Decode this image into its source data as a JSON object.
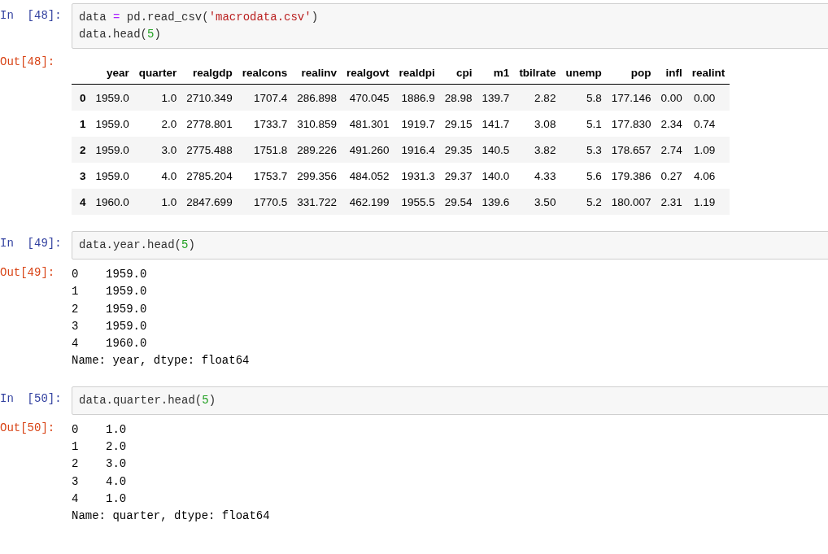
{
  "cells": [
    {
      "in_prompt": "In  [48]:",
      "code": [
        [
          {
            "kind": "name",
            "text": "data "
          },
          {
            "kind": "operator",
            "text": "="
          },
          {
            "kind": "name",
            "text": " pd.read_csv("
          },
          {
            "kind": "string",
            "text": "'macrodata.csv'"
          },
          {
            "kind": "name",
            "text": ")"
          }
        ],
        [
          {
            "kind": "name",
            "text": "data.head("
          },
          {
            "kind": "number",
            "text": "5"
          },
          {
            "kind": "name",
            "text": ")"
          }
        ]
      ],
      "out_prompt": "Out[48]:",
      "output": {
        "kind": "table",
        "columns": [
          "year",
          "quarter",
          "realgdp",
          "realcons",
          "realinv",
          "realgovt",
          "realdpi",
          "cpi",
          "m1",
          "tbilrate",
          "unemp",
          "pop",
          "infl",
          "realint"
        ],
        "rows": [
          {
            "index": "0",
            "cells": [
              "1959.0",
              "1.0",
              "2710.349",
              "1707.4",
              "286.898",
              "470.045",
              "1886.9",
              "28.98",
              "139.7",
              "2.82",
              "5.8",
              "177.146",
              "0.00",
              "0.00"
            ]
          },
          {
            "index": "1",
            "cells": [
              "1959.0",
              "2.0",
              "2778.801",
              "1733.7",
              "310.859",
              "481.301",
              "1919.7",
              "29.15",
              "141.7",
              "3.08",
              "5.1",
              "177.830",
              "2.34",
              "0.74"
            ]
          },
          {
            "index": "2",
            "cells": [
              "1959.0",
              "3.0",
              "2775.488",
              "1751.8",
              "289.226",
              "491.260",
              "1916.4",
              "29.35",
              "140.5",
              "3.82",
              "5.3",
              "178.657",
              "2.74",
              "1.09"
            ]
          },
          {
            "index": "3",
            "cells": [
              "1959.0",
              "4.0",
              "2785.204",
              "1753.7",
              "299.356",
              "484.052",
              "1931.3",
              "29.37",
              "140.0",
              "4.33",
              "5.6",
              "179.386",
              "0.27",
              "4.06"
            ]
          },
          {
            "index": "4",
            "cells": [
              "1960.0",
              "1.0",
              "2847.699",
              "1770.5",
              "331.722",
              "462.199",
              "1955.5",
              "29.54",
              "139.6",
              "3.50",
              "5.2",
              "180.007",
              "2.31",
              "1.19"
            ]
          }
        ]
      }
    },
    {
      "in_prompt": "In  [49]:",
      "code": [
        [
          {
            "kind": "name",
            "text": "data.year.head("
          },
          {
            "kind": "number",
            "text": "5"
          },
          {
            "kind": "name",
            "text": ")"
          }
        ]
      ],
      "out_prompt": "Out[49]:",
      "output": {
        "kind": "text",
        "lines": [
          "0    1959.0",
          "1    1959.0",
          "2    1959.0",
          "3    1959.0",
          "4    1960.0",
          "Name: year, dtype: float64"
        ]
      }
    },
    {
      "in_prompt": "In  [50]:",
      "code": [
        [
          {
            "kind": "name",
            "text": "data.quarter.head("
          },
          {
            "kind": "number",
            "text": "5"
          },
          {
            "kind": "name",
            "text": ")"
          }
        ]
      ],
      "out_prompt": "Out[50]:",
      "output": {
        "kind": "text",
        "lines": [
          "0    1.0",
          "1    2.0",
          "2    3.0",
          "3    4.0",
          "4    1.0",
          "Name: quarter, dtype: float64"
        ]
      }
    }
  ]
}
